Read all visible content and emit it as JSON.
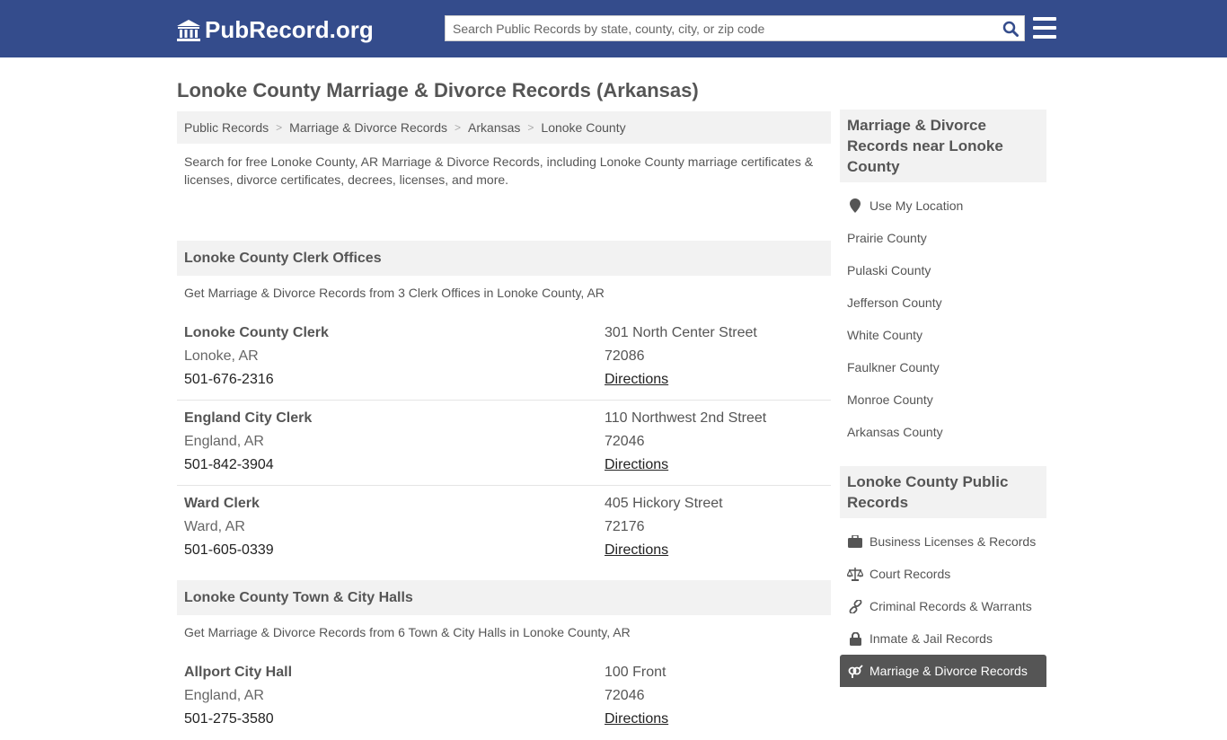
{
  "header": {
    "logo_text": "PubRecord.org",
    "search_placeholder": "Search Public Records by state, county, city, or zip code"
  },
  "page_title": "Lonoke County Marriage & Divorce Records (Arkansas)",
  "breadcrumbs": [
    "Public Records",
    "Marriage & Divorce Records",
    "Arkansas",
    "Lonoke County"
  ],
  "intro": "Search for free Lonoke County, AR Marriage & Divorce Records, including Lonoke County marriage certificates & licenses, divorce certificates, decrees, licenses, and more.",
  "sections": [
    {
      "title": "Lonoke County Clerk Offices",
      "description": "Get Marriage & Divorce Records from 3 Clerk Offices in Lonoke County, AR",
      "offices": [
        {
          "name": "Lonoke County Clerk",
          "city": "Lonoke, AR",
          "phone": "501-676-2316",
          "address": "301 North Center Street",
          "zip": "72086",
          "directions": "Directions"
        },
        {
          "name": "England City Clerk",
          "city": "England, AR",
          "phone": "501-842-3904",
          "address": "110 Northwest 2nd Street",
          "zip": "72046",
          "directions": "Directions"
        },
        {
          "name": "Ward Clerk",
          "city": "Ward, AR",
          "phone": "501-605-0339",
          "address": "405 Hickory Street",
          "zip": "72176",
          "directions": "Directions"
        }
      ]
    },
    {
      "title": "Lonoke County Town & City Halls",
      "description": "Get Marriage & Divorce Records from 6 Town & City Halls in Lonoke County, AR",
      "offices": [
        {
          "name": "Allport City Hall",
          "city": "England, AR",
          "phone": "501-275-3580",
          "address": "100 Front",
          "zip": "72046",
          "directions": "Directions"
        }
      ]
    }
  ],
  "sidebar": {
    "nearby_title": "Marriage & Divorce Records near Lonoke County",
    "use_location": "Use My Location",
    "nearby": [
      "Prairie County",
      "Pulaski County",
      "Jefferson County",
      "White County",
      "Faulkner County",
      "Monroe County",
      "Arkansas County"
    ],
    "public_title": "Lonoke County Public Records",
    "public": [
      {
        "label": "Business Licenses & Records",
        "icon": "briefcase-icon"
      },
      {
        "label": "Court Records",
        "icon": "scales-icon"
      },
      {
        "label": "Criminal Records & Warrants",
        "icon": "link-icon"
      },
      {
        "label": "Inmate & Jail Records",
        "icon": "lock-icon"
      },
      {
        "label": "Marriage & Divorce Records",
        "icon": "gender-icon",
        "active": true
      }
    ]
  }
}
